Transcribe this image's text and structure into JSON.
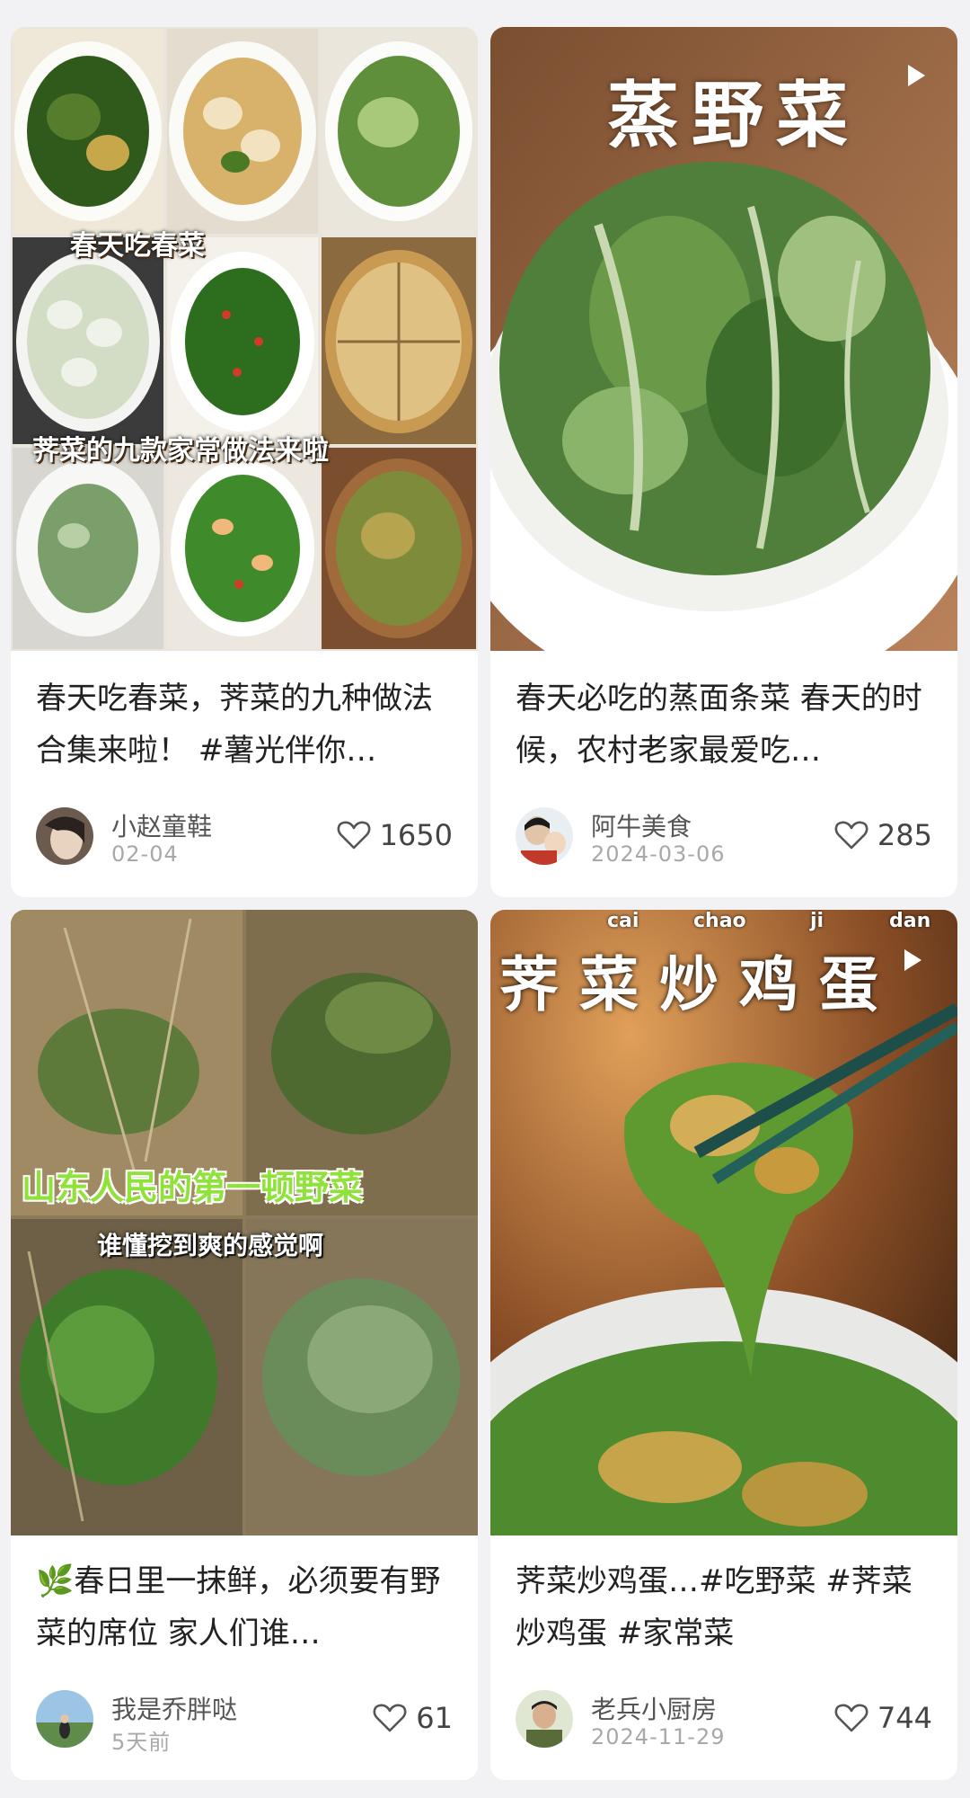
{
  "cards": [
    {
      "title": "春天吃春菜，荠菜的九种做法合集来啦！ #薯光伴你…",
      "overlay_top": "春天吃春菜",
      "overlay_mid": "荠菜的九款家常做法来啦",
      "author": "小赵童鞋",
      "date": "02-04",
      "likes": "1650"
    },
    {
      "title": "春天必吃的蒸面条菜 春天的时候，农村老家最爱吃…",
      "overlay_top": "蒸野菜",
      "author": "阿牛美食",
      "date": "2024-03-06",
      "likes": "285",
      "icon": "play-icon"
    },
    {
      "title": "🌿春日里一抹鲜，必须要有野菜的席位 家人们谁…",
      "overlay_top": "山东人民的第一顿野菜",
      "overlay_mid": "谁懂挖到爽的感觉啊",
      "author": "我是乔胖哒",
      "date": "5天前",
      "likes": "61"
    },
    {
      "title": "荠菜炒鸡蛋…#吃野菜 #荠菜炒鸡蛋 #家常菜",
      "overlay_top": "荠 菜 炒 鸡 蛋",
      "pinyin": [
        "cai",
        "chao",
        "ji",
        "dan"
      ],
      "author": "老兵小厨房",
      "date": "2024-11-29",
      "likes": "744",
      "icon": "play-icon"
    }
  ],
  "colors": {
    "background": "#f2f2f4",
    "card": "#ffffff",
    "title": "#222222",
    "meta": "#a8a8a8",
    "overlay_green": "#8fe23a"
  }
}
